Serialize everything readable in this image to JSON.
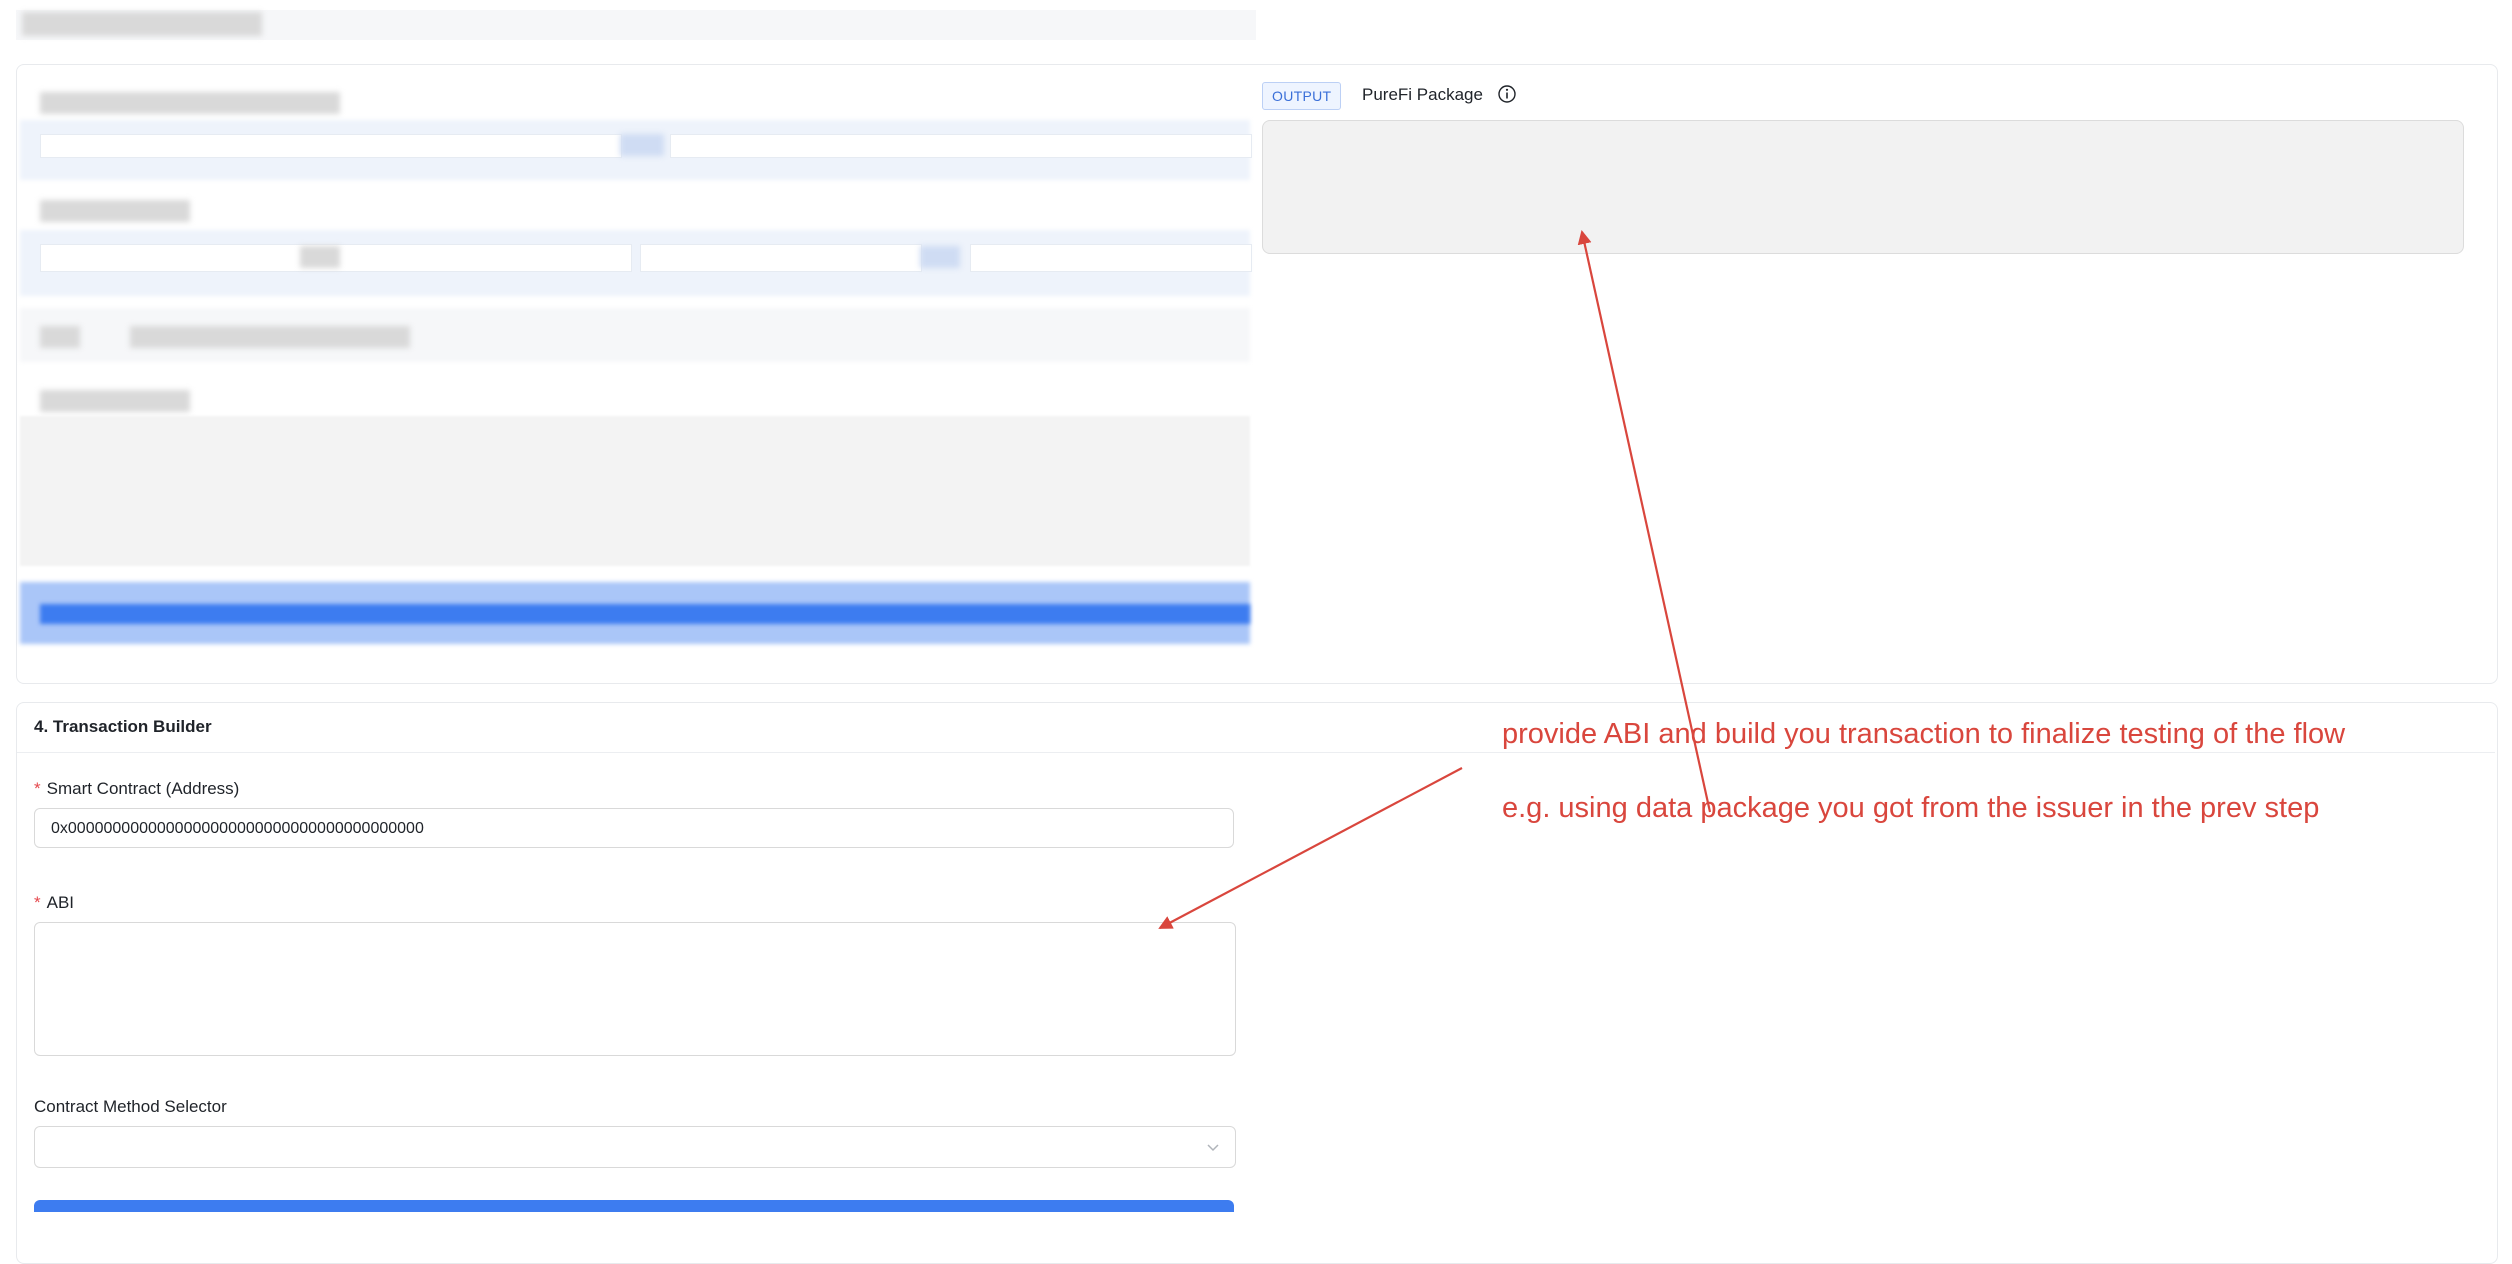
{
  "output_panel": {
    "tag": "OUTPUT",
    "title": "PureFi Package",
    "value": ""
  },
  "transaction_builder": {
    "title": "4. Transaction Builder",
    "smart_contract": {
      "required_mark": "*",
      "label": "Smart Contract (Address)",
      "value": "0x0000000000000000000000000000000000000000"
    },
    "abi": {
      "required_mark": "*",
      "label": "ABI",
      "value": ""
    },
    "method_selector": {
      "label": "Contract Method Selector",
      "value": ""
    }
  },
  "annotations": {
    "line1": "provide ABI and build you transaction to finalize testing of the flow",
    "line2": "e.g. using data package you got from the issuer in the prev step",
    "color": "#d9463d"
  },
  "colors": {
    "accent_blue": "#3d7cf0",
    "required_red": "#e5484d",
    "output_tag_text": "#3a6fd8"
  }
}
